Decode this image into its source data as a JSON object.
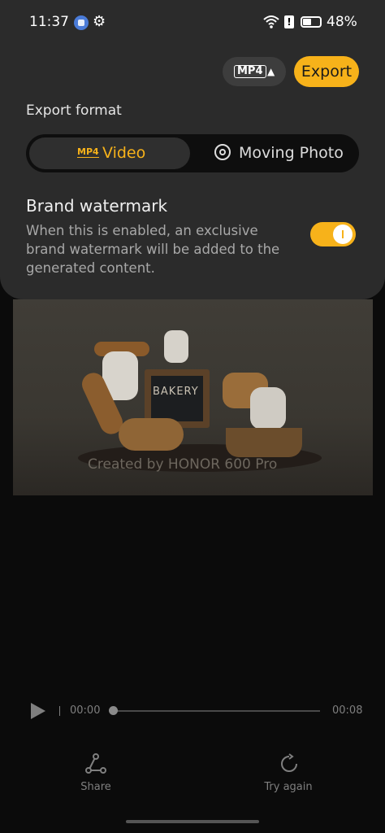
{
  "status_bar": {
    "time": "11:37",
    "battery": "48%"
  },
  "header": {
    "format_chip_label": "MP4",
    "export_label": "Export"
  },
  "export_format": {
    "label": "Export format",
    "options": [
      {
        "badge": "MP4",
        "label": "Video",
        "selected": true
      },
      {
        "label": "Moving Photo",
        "selected": false
      }
    ]
  },
  "brand_watermark": {
    "title": "Brand watermark",
    "description": "When this is enabled, an exclusive brand watermark will be added to the generated content.",
    "enabled": true
  },
  "preview": {
    "board_text": "BAKERY",
    "watermark_text": "Created by HONOR 600 Pro"
  },
  "player": {
    "current_time": "00:00",
    "duration": "00:08",
    "progress": 0
  },
  "actions": {
    "share_label": "Share",
    "try_again_label": "Try again"
  },
  "colors": {
    "accent": "#f7b21a",
    "panel": "#2b2b2b",
    "background": "#0b0b0b"
  }
}
